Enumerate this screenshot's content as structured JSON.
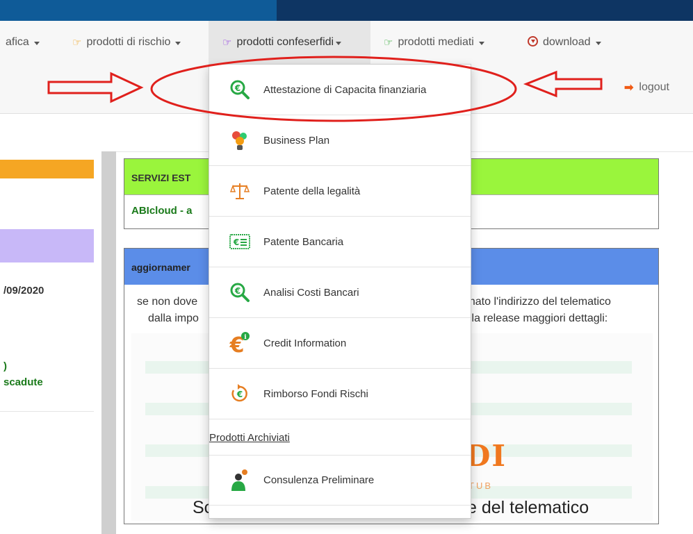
{
  "nav": {
    "items": [
      {
        "label": "afica",
        "icon": "",
        "caret": true
      },
      {
        "label": "prodotti di rischio",
        "icon": "pointing-hand-icon",
        "caret": true
      },
      {
        "label": "prodotti confeserfidi",
        "icon": "pointing-hand-icon",
        "caret": true,
        "active": true
      },
      {
        "label": "prodotti mediati",
        "icon": "pointing-hand-icon",
        "caret": true
      },
      {
        "label": "download",
        "icon": "download-icon",
        "caret": true
      }
    ],
    "logout": "logout"
  },
  "left": {
    "date": "/09/2020",
    "paren": ")",
    "scadute": "scadute"
  },
  "panels": {
    "servizi": {
      "title": "SERVIZI EST",
      "body": "ABIcloud - a"
    },
    "aggiornamenti": {
      "title": "aggiornamer",
      "line1_left": "se non dove",
      "line2_left": "dalla impo",
      "line1_right": "minato l'indirizzo del telematico",
      "line2_right": "lla release maggiori dettagli:",
      "logo_text": "DI",
      "logo_sub": "TUB",
      "banner_left": "Sc",
      "banner_right": "e del telematico"
    }
  },
  "dropdown": {
    "items": [
      {
        "label": "Attestazione di Capacita finanziaria",
        "icon": "euro-magnifier-icon"
      },
      {
        "label": "Business Plan",
        "icon": "lightbulb-gears-icon"
      },
      {
        "label": "Patente della legalità",
        "icon": "scales-icon"
      },
      {
        "label": "Patente Bancaria",
        "icon": "euro-card-icon"
      },
      {
        "label": "Analisi Costi Bancari",
        "icon": "euro-magnifier-icon"
      },
      {
        "label": "Credit Information",
        "icon": "euro-info-icon"
      },
      {
        "label": "Rimborso Fondi Rischi",
        "icon": "euro-refresh-icon"
      }
    ],
    "archived_header": "Prodotti Archiviati",
    "archived_items": [
      {
        "label": "Consulenza Preliminare",
        "icon": "consultant-icon"
      }
    ]
  },
  "colors": {
    "topbar_left": "#0f5b98",
    "topbar_right": "#0e3563",
    "annotation_red": "#e0201c",
    "panel_green": "#9af53c",
    "panel_blue": "#5b8de8"
  }
}
